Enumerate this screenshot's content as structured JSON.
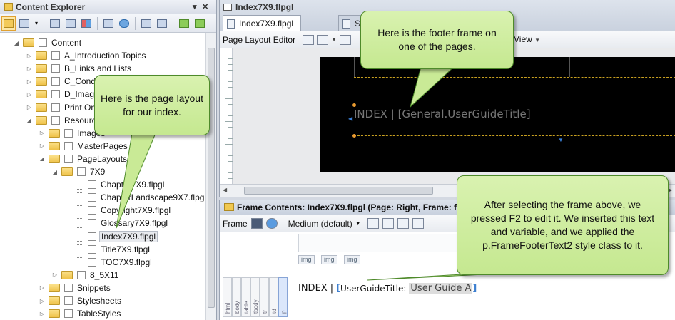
{
  "content_explorer": {
    "title": "Content Explorer",
    "pin": "📌",
    "close": "✕",
    "tree": [
      {
        "label": "Content",
        "type": "folder",
        "arrow": "◢"
      },
      {
        "label": "A_Introduction Topics",
        "type": "folder",
        "arrow": "▷"
      },
      {
        "label": "B_Links and Lists",
        "type": "folder",
        "arrow": "▷"
      },
      {
        "label": "C_Conditi",
        "type": "folder",
        "arrow": "▷"
      },
      {
        "label": "D_Images",
        "type": "folder",
        "arrow": "▷"
      },
      {
        "label": "Print Only",
        "type": "folder",
        "arrow": "▷"
      },
      {
        "label": "Resource",
        "type": "folder",
        "arrow": "◢"
      },
      {
        "label": "Images",
        "type": "folder",
        "arrow": "▷"
      },
      {
        "label": "MasterPages",
        "type": "folder",
        "arrow": "▷"
      },
      {
        "label": "PageLayouts",
        "type": "folder",
        "arrow": "◢"
      },
      {
        "label": "7X9",
        "type": "folder",
        "arrow": "◢"
      },
      {
        "label": "Chapter7X9.flpgl",
        "type": "file",
        "arrow": ""
      },
      {
        "label": "ChapterLandscape9X7.flpgl",
        "type": "file",
        "arrow": ""
      },
      {
        "label": "Copyright7X9.flpgl",
        "type": "file",
        "arrow": ""
      },
      {
        "label": "Glossary7X9.flpgl",
        "type": "file",
        "arrow": ""
      },
      {
        "label": "Index7X9.flpgl",
        "type": "file",
        "arrow": "",
        "selected": true
      },
      {
        "label": "Title7X9.flpgl",
        "type": "file",
        "arrow": ""
      },
      {
        "label": "TOC7X9.flpgl",
        "type": "file",
        "arrow": ""
      },
      {
        "label": "8_5X11",
        "type": "folder",
        "arrow": "▷"
      },
      {
        "label": "Snippets",
        "type": "folder",
        "arrow": "▷"
      },
      {
        "label": "Stylesheets",
        "type": "folder",
        "arrow": "▷"
      },
      {
        "label": "TableStyles",
        "type": "folder",
        "arrow": "▷"
      }
    ]
  },
  "editor": {
    "window_title": "Index7X9.flpgl",
    "tabs": [
      {
        "label": "Index7X9.flpgl",
        "active": true
      },
      {
        "label": "Sa",
        "active": false
      }
    ],
    "toolbar_label": "Page Layout Editor",
    "view_label": "View",
    "footer_text": "INDEX",
    "footer_sep": "|",
    "footer_variable": "[General.UserGuideTitle]"
  },
  "frame_contents": {
    "title": "Frame Contents: Index7X9.flpgl (Page: Right, Frame: fo",
    "frame_menu": "Frame",
    "style_value": "Medium (default)",
    "img_tags": [
      "img",
      "img",
      "img"
    ],
    "structure_labels": [
      "html",
      "body",
      "table",
      "tbody",
      "tr",
      "td",
      "p"
    ],
    "edit_text": "INDEX",
    "edit_sep": "|",
    "variable_name": "UserGuideTitle:",
    "variable_value": "User Guide A"
  },
  "callouts": {
    "footer_frame": "Here is the footer frame on one of the pages.",
    "page_layout": "Here is the page layout for our index.",
    "after_selecting": "After selecting the frame above, we pressed F2 to edit it. We inserted this text and variable, and we applied the p.FrameFooterText2 style class to it."
  },
  "colors": {
    "callout_fill": "#c5e890",
    "callout_border": "#4e8a2a",
    "page_background": "#000000"
  },
  "icons": [
    "content-explorer-icon",
    "folder-icon",
    "file-icon",
    "save-icon",
    "refresh-icon",
    "image-icon",
    "pin-icon",
    "close-icon"
  ]
}
